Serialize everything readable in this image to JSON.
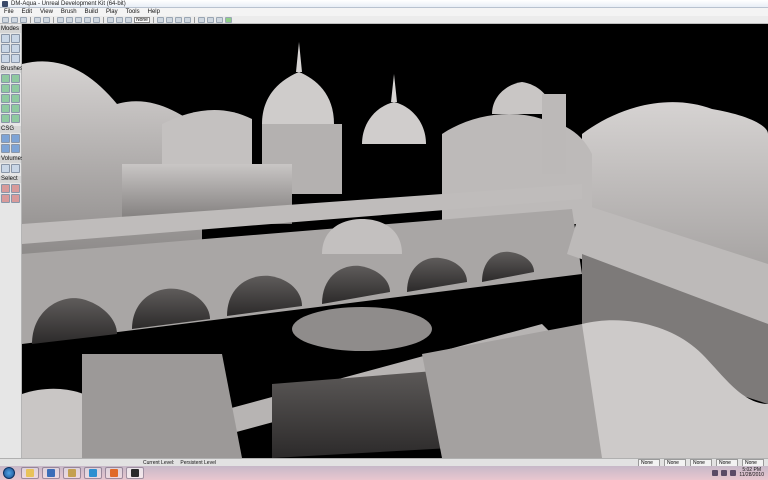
{
  "window": {
    "title": "DM-Aqua - Unreal Development Kit (64-bit)"
  },
  "menu": {
    "items": [
      "File",
      "Edit",
      "View",
      "Brush",
      "Build",
      "Play",
      "Tools",
      "Help"
    ]
  },
  "toolbar": {
    "grid_combo": "None"
  },
  "left_panel": {
    "sections": {
      "modes": "Modes",
      "brushes": "Brushes",
      "csg": "CSG",
      "volumes": "Volumes",
      "select": "Select"
    }
  },
  "status_bar": {
    "current_level_label": "Current Level:",
    "current_level_value": "Persistent Level",
    "fields": [
      "None",
      "None",
      "None",
      "None",
      "None"
    ]
  },
  "taskbar": {
    "apps": [
      "windows-explorer",
      "file-manager",
      "media-player",
      "tools",
      "web-browser",
      "firefox",
      "udk"
    ],
    "clock_time": "5:02 PM",
    "clock_date": "11/28/2010"
  },
  "colors": {
    "viewport_background": "#000000",
    "geometry_light": "#cfcccb",
    "geometry_dark": "#6e6b6a",
    "taskbar": "#e6c4cd"
  }
}
